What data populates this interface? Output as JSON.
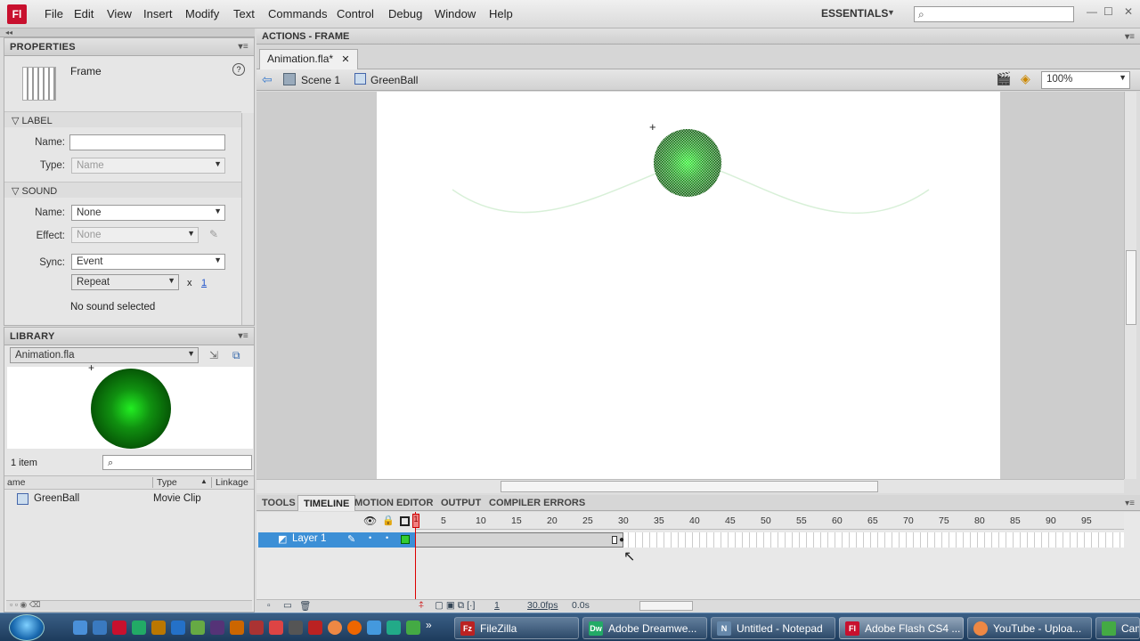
{
  "app": {
    "logo": "Fl"
  },
  "menu": [
    "File",
    "Edit",
    "View",
    "Insert",
    "Modify",
    "Text",
    "Commands",
    "Control",
    "Debug",
    "Window",
    "Help"
  ],
  "workspace": "ESSENTIALS",
  "properties": {
    "title": "PROPERTIES",
    "frame_label": "Frame",
    "label_section": "LABEL",
    "name_label": "Name:",
    "name_value": "",
    "type_label": "Type:",
    "type_value": "Name",
    "sound_section": "SOUND",
    "sound_name_label": "Name:",
    "sound_name_value": "None",
    "effect_label": "Effect:",
    "effect_value": "None",
    "sync_label": "Sync:",
    "sync_value": "Event",
    "repeat_value": "Repeat",
    "repeat_x": "x",
    "repeat_count": "1",
    "no_sound": "No sound selected"
  },
  "library": {
    "title": "LIBRARY",
    "file": "Animation.fla",
    "count": "1 item",
    "columns": [
      "ame",
      "Type",
      "Linkage"
    ],
    "items": [
      {
        "name": "GreenBall",
        "type": "Movie Clip",
        "linkage": ""
      }
    ]
  },
  "actions_panel": "ACTIONS - FRAME",
  "document_tab": "Animation.fla*",
  "breadcrumb": {
    "scene": "Scene 1",
    "symbol": "GreenBall"
  },
  "zoom": "100%",
  "timeline_tabs": [
    "TOOLS",
    "TIMELINE",
    "MOTION EDITOR",
    "OUTPUT",
    "COMPILER ERRORS"
  ],
  "timeline": {
    "ruler": [
      "1",
      "5",
      "10",
      "15",
      "20",
      "25",
      "30",
      "35",
      "40",
      "45",
      "50",
      "55",
      "60",
      "65",
      "70",
      "75",
      "80",
      "85",
      "90",
      "95"
    ],
    "layer": "Layer 1",
    "current_frame": "1",
    "fps": "30.0fps",
    "time": "0.0s"
  },
  "taskbar": {
    "tasks": [
      {
        "label": "FileZilla",
        "color": "#b22"
      },
      {
        "label": "Adobe Dreamwe...",
        "color": "#2a6"
      },
      {
        "label": "Untitled - Notepad",
        "color": "#68a"
      },
      {
        "label": "Adobe Flash CS4 ...",
        "color": "#c8102e"
      },
      {
        "label": "YouTube - Uploa...",
        "color": "#e84"
      },
      {
        "label": "Cam",
        "color": "#4a4"
      }
    ]
  }
}
